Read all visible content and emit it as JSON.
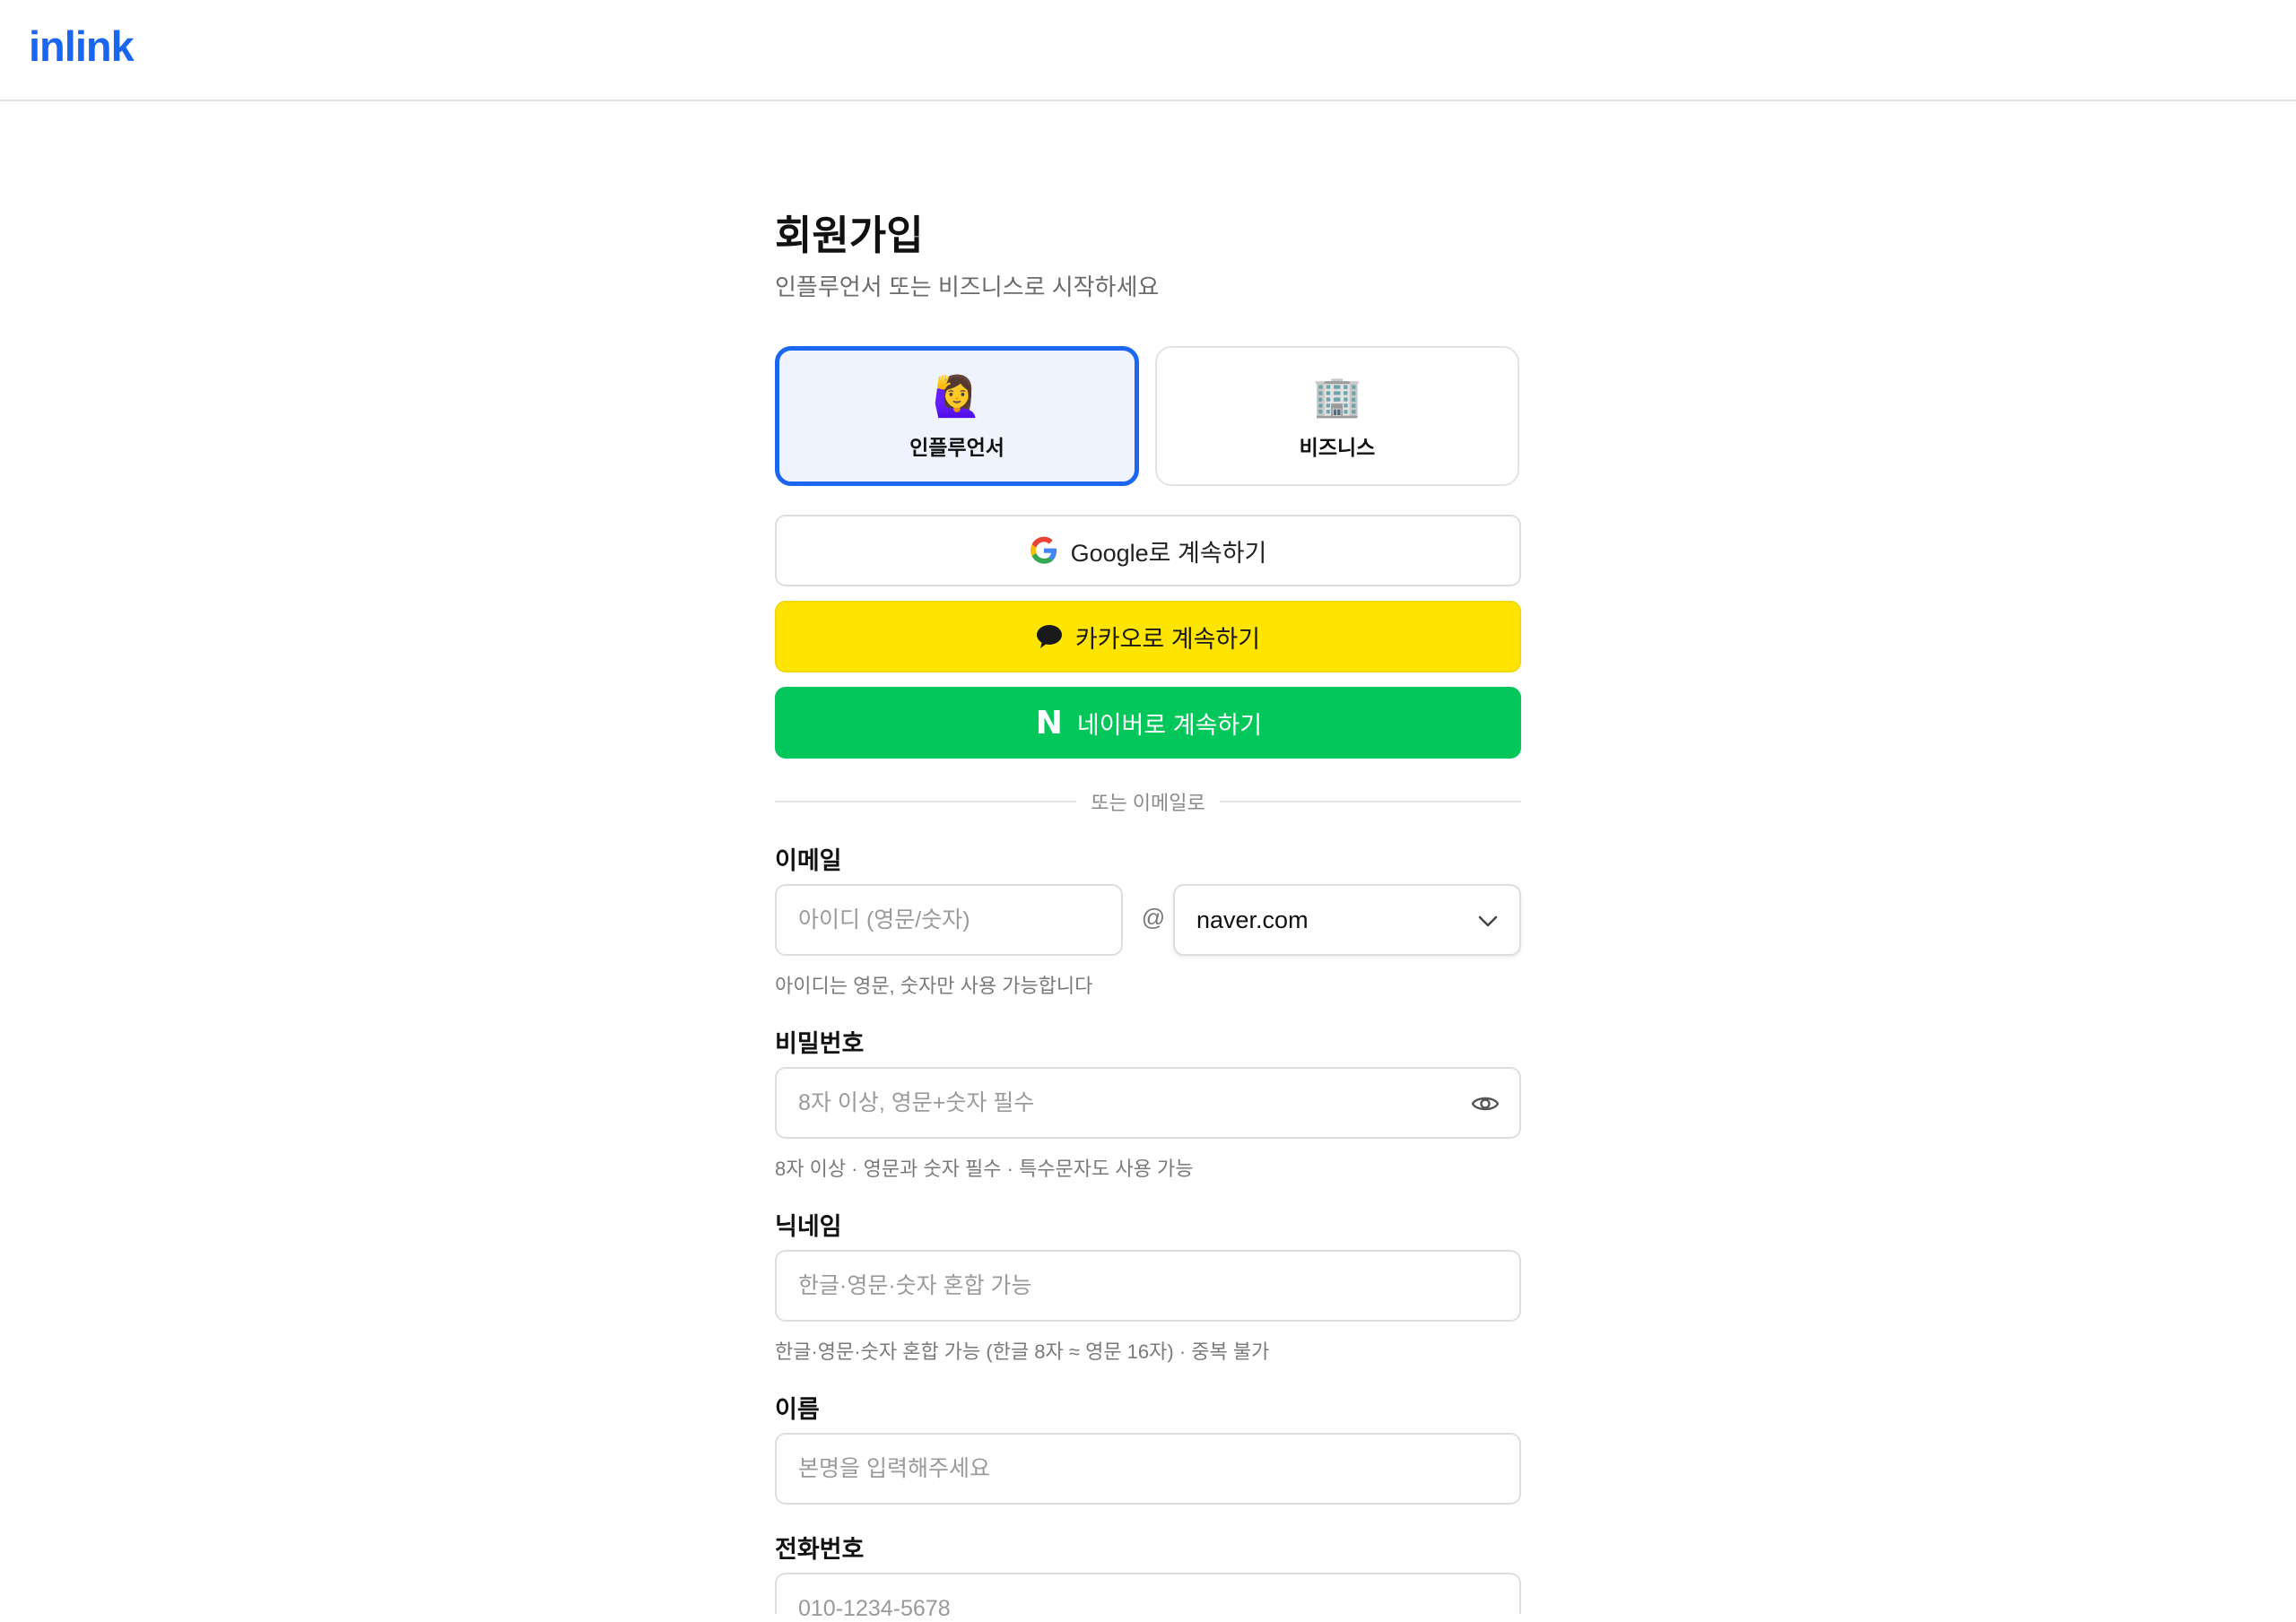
{
  "header": {
    "logo": "inlink"
  },
  "page": {
    "title": "회원가입",
    "subtitle": "인플루언서 또는 비즈니스로 시작하세요"
  },
  "roles": [
    {
      "emoji": "🙋‍♀️",
      "label": "인플루언서",
      "selected": true
    },
    {
      "emoji": "🏢",
      "label": "비즈니스",
      "selected": false
    }
  ],
  "social": {
    "google_label": "Google로 계속하기",
    "kakao_label": "카카오로 계속하기",
    "naver_label": "네이버로 계속하기",
    "naver_icon_text": "N"
  },
  "divider": {
    "text": "또는 이메일로"
  },
  "form": {
    "email": {
      "label": "이메일",
      "id_placeholder": "아이디 (영문/숫자)",
      "at": "@",
      "domain_value": "naver.com",
      "helper": "아이디는 영문, 숫자만 사용 가능합니다"
    },
    "password": {
      "label": "비밀번호",
      "placeholder": "8자 이상, 영문+숫자 필수",
      "helper": "8자 이상 · 영문과 숫자 필수 · 특수문자도 사용 가능"
    },
    "nickname": {
      "label": "닉네임",
      "placeholder": "한글·영문·숫자 혼합 가능",
      "helper": "한글·영문·숫자 혼합 가능 (한글 8자 ≈ 영문 16자) · 중복 불가"
    },
    "name": {
      "label": "이름",
      "placeholder": "본명을 입력해주세요"
    },
    "phone": {
      "label": "전화번호",
      "placeholder": "010-1234-5678"
    }
  },
  "colors": {
    "brand": "#1a66f0",
    "kakao": "#fee500",
    "naver": "#03c75a",
    "selected_bg": "#eef3fd"
  }
}
